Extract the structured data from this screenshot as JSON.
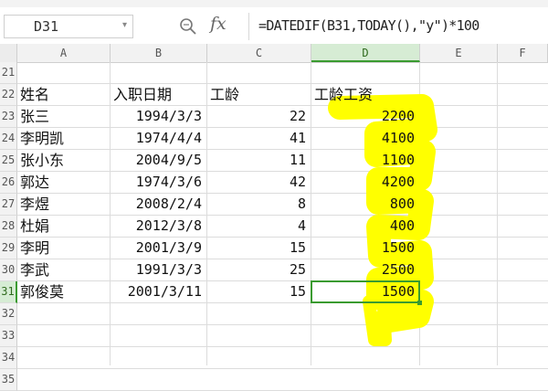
{
  "name_box": {
    "value": "D31"
  },
  "formula_bar": {
    "fx_label": "fx",
    "formula": "=DATEDIF(B31,TODAY(),\"y\")*100"
  },
  "columns": [
    "A",
    "B",
    "C",
    "D",
    "E",
    "F"
  ],
  "active_column": "D",
  "rows": [
    "21",
    "22",
    "23",
    "24",
    "25",
    "26",
    "27",
    "28",
    "29",
    "30",
    "31",
    "32",
    "33",
    "34",
    "35"
  ],
  "active_row": "31",
  "table": {
    "headers": [
      "姓名",
      "入职日期",
      "工龄",
      "工龄工资"
    ],
    "records": [
      {
        "name": "张三",
        "date": "1994/3/3",
        "years": "22",
        "wage": "2200"
      },
      {
        "name": "李明凯",
        "date": "1974/4/4",
        "years": "41",
        "wage": "4100"
      },
      {
        "name": "张小东",
        "date": "2004/9/5",
        "years": "11",
        "wage": "1100"
      },
      {
        "name": "郭达",
        "date": "1974/3/6",
        "years": "42",
        "wage": "4200"
      },
      {
        "name": "李煜",
        "date": "2008/2/4",
        "years": "8",
        "wage": "800"
      },
      {
        "name": "杜娟",
        "date": "2012/3/8",
        "years": "4",
        "wage": "400"
      },
      {
        "name": "李明",
        "date": "2001/3/9",
        "years": "15",
        "wage": "1500"
      },
      {
        "name": "李武",
        "date": "1991/3/3",
        "years": "25",
        "wage": "2500"
      },
      {
        "name": "郭俊莫",
        "date": "2001/3/11",
        "years": "15",
        "wage": "1500"
      }
    ]
  },
  "colors": {
    "selection": "#3a9b30",
    "highlight": "#ffff00"
  }
}
